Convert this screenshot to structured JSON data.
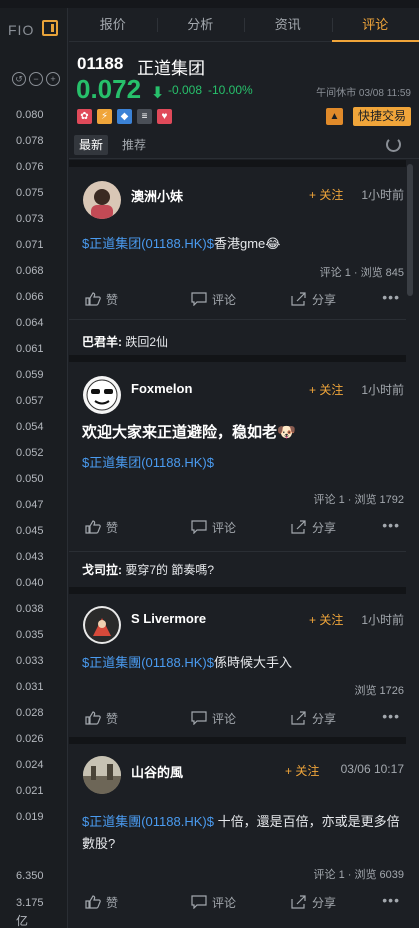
{
  "left_panel": {
    "fio_label": "FIO",
    "prices": [
      "0.080",
      "0.078",
      "0.076",
      "0.075",
      "0.073",
      "0.071",
      "0.068",
      "0.066",
      "0.064",
      "0.061",
      "0.059",
      "0.057",
      "0.054",
      "0.052",
      "0.050",
      "0.047",
      "0.045",
      "0.043",
      "0.040",
      "0.038",
      "0.035",
      "0.033",
      "0.031",
      "0.028",
      "0.026",
      "0.024",
      "0.021",
      "0.019"
    ],
    "footer_value_1": "6.350",
    "footer_value_2": "3.175",
    "footer_unit": "亿"
  },
  "tabs": [
    "报价",
    "分析",
    "资讯",
    "评论"
  ],
  "active_tab": "评论",
  "quote": {
    "code": "01188",
    "name": "正道集团",
    "price": "0.072",
    "change": "-0.008",
    "change_pct": "-10.00%",
    "status": "午间休市 03/08 11:59",
    "quick_trade": "快捷交易",
    "colors": {
      "down": "#27c06b",
      "accent": "#f0a53a"
    }
  },
  "subtabs": [
    "最新",
    "推荐"
  ],
  "posts": [
    {
      "author": "澳洲小妹",
      "follow": "+ 关注",
      "time": "1小时前",
      "ticker": "$正道集团(01188.HK)$",
      "body": "香港gme😂",
      "stats": "评论 1 · 浏览 845",
      "actions": [
        "赞",
        "评论",
        "分享"
      ],
      "reply_author": "巴君羊:",
      "reply_text": "跌回2仙"
    },
    {
      "author": "Foxmelon",
      "follow": "+ 关注",
      "time": "1小时前",
      "title": "欢迎大家来正道避险，稳如老🐶",
      "ticker": "$正道集团(01188.HK)$",
      "stats": "评论 1 · 浏览 1792",
      "actions": [
        "赞",
        "评论",
        "分享"
      ],
      "reply_author": "戈司拉:",
      "reply_text": "要穿7的 節奏嗎?"
    },
    {
      "author": "S Livermore",
      "follow": "+ 关注",
      "time": "1小时前",
      "ticker": "$正道集團(01188.HK)$",
      "body": "係時候大手入",
      "stats": "浏览 1726",
      "actions": [
        "赞",
        "评论",
        "分享"
      ]
    },
    {
      "author": "山谷的風",
      "follow": "+ 关注",
      "time": "03/06 10:17",
      "ticker": "$正道集團(01188.HK)$",
      "body": " 十倍，還是百倍，亦或是更多倍數股?",
      "stats": "评论 1 · 浏览 6039",
      "actions": [
        "赞",
        "评论",
        "分享"
      ]
    }
  ]
}
